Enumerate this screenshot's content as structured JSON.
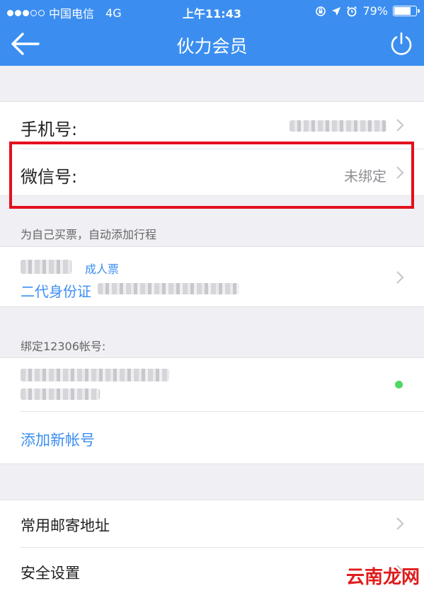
{
  "status_bar": {
    "carrier": "中国电信",
    "network": "4G",
    "time": "上午11:43",
    "battery": "79%",
    "battery_level": 0.79
  },
  "nav": {
    "title": "伙力会员"
  },
  "account": {
    "phone_label": "手机号:",
    "wechat_label": "微信号:",
    "wechat_value": "未绑定"
  },
  "passenger": {
    "caption": "为自己买票，自动添加行程",
    "ticket_type": "成人票",
    "id_type": "二代身份证"
  },
  "railway": {
    "caption": "绑定12306帐号:",
    "add_account": "添加新帐号"
  },
  "settings": {
    "address": "常用邮寄地址",
    "security": "安全设置"
  },
  "watermark": "云南龙网"
}
